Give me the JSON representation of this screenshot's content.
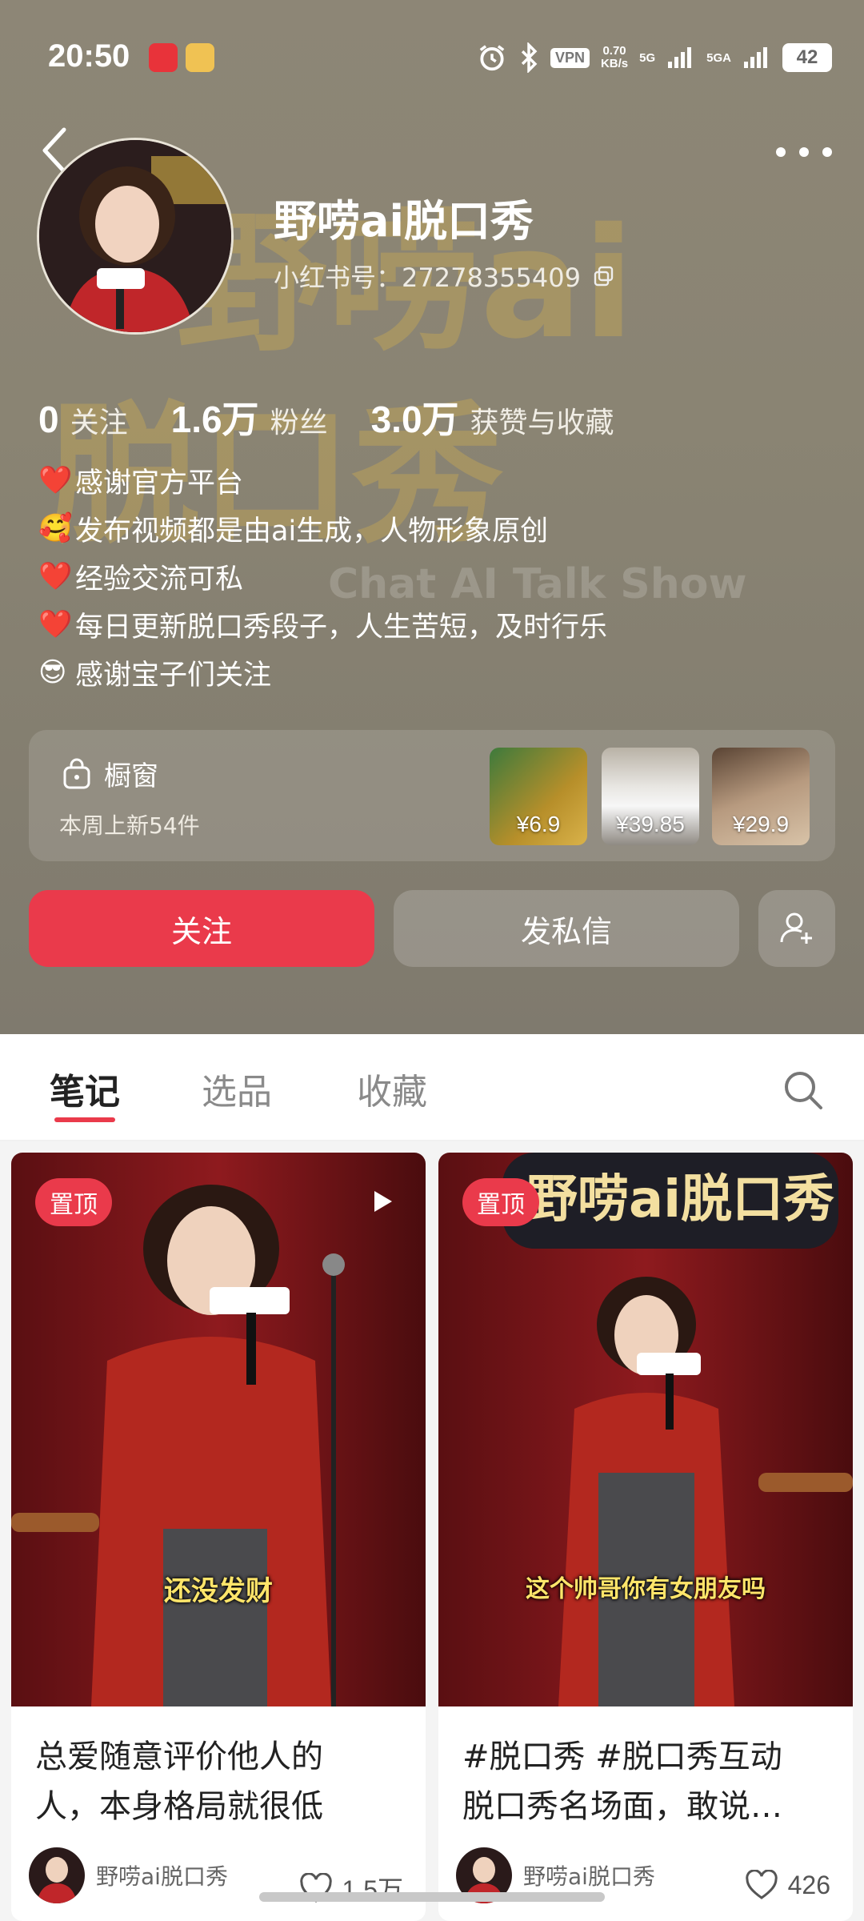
{
  "status_bar": {
    "time": "20:50",
    "vpn": "VPN",
    "net_speed_value": "0.70",
    "net_speed_unit": "KB/s",
    "signal1": "5G",
    "signal2": "5GA",
    "battery": "42"
  },
  "profile": {
    "name": "野唠ai脱口秀",
    "id_label": "小红书号：27278355409",
    "stats": [
      {
        "value": "0",
        "label": "关注"
      },
      {
        "value": "1.6万",
        "label": "粉丝"
      },
      {
        "value": "3.0万",
        "label": "获赞与收藏"
      }
    ],
    "bio": [
      {
        "emoji": "❤️",
        "text": "感谢官方平台"
      },
      {
        "emoji": "🥰",
        "text": "发布视频都是由ai生成，人物形象原创"
      },
      {
        "emoji": "❤️",
        "text": "经验交流可私"
      },
      {
        "emoji": "❤️",
        "text": "每日更新脱口秀段子，人生苦短，及时行乐"
      },
      {
        "emoji": "😎",
        "text": "感谢宝子们关注"
      }
    ]
  },
  "shop": {
    "title": "橱窗",
    "subtitle": "本周上新54件",
    "items": [
      {
        "price": "¥6.9"
      },
      {
        "price": "¥39.85"
      },
      {
        "price": "¥29.9"
      }
    ]
  },
  "actions": {
    "follow": "关注",
    "message": "发私信"
  },
  "tabs": [
    {
      "label": "笔记",
      "active": true
    },
    {
      "label": "选品",
      "active": false
    },
    {
      "label": "收藏",
      "active": false
    }
  ],
  "feed": [
    {
      "badge": "置顶",
      "title_line1": "总爱随意评价他人的",
      "title_line2": "人，本身格局就很低",
      "subtitle_overlay": "还没发财",
      "author": "野唠ai脱口秀",
      "likes": "1.5万"
    },
    {
      "badge": "置顶",
      "title_line1": "#脱口秀 #脱口秀互动",
      "title_line2": "脱口秀名场面，敢说…",
      "subtitle_overlay": "这个帅哥你有女朋友吗",
      "author": "野唠ai脱口秀",
      "likes": "426"
    }
  ],
  "icons": [
    "back-arrow-icon",
    "more-icon",
    "copy-icon",
    "bag-icon",
    "add-user-icon",
    "search-icon",
    "play-icon",
    "heart-icon"
  ]
}
